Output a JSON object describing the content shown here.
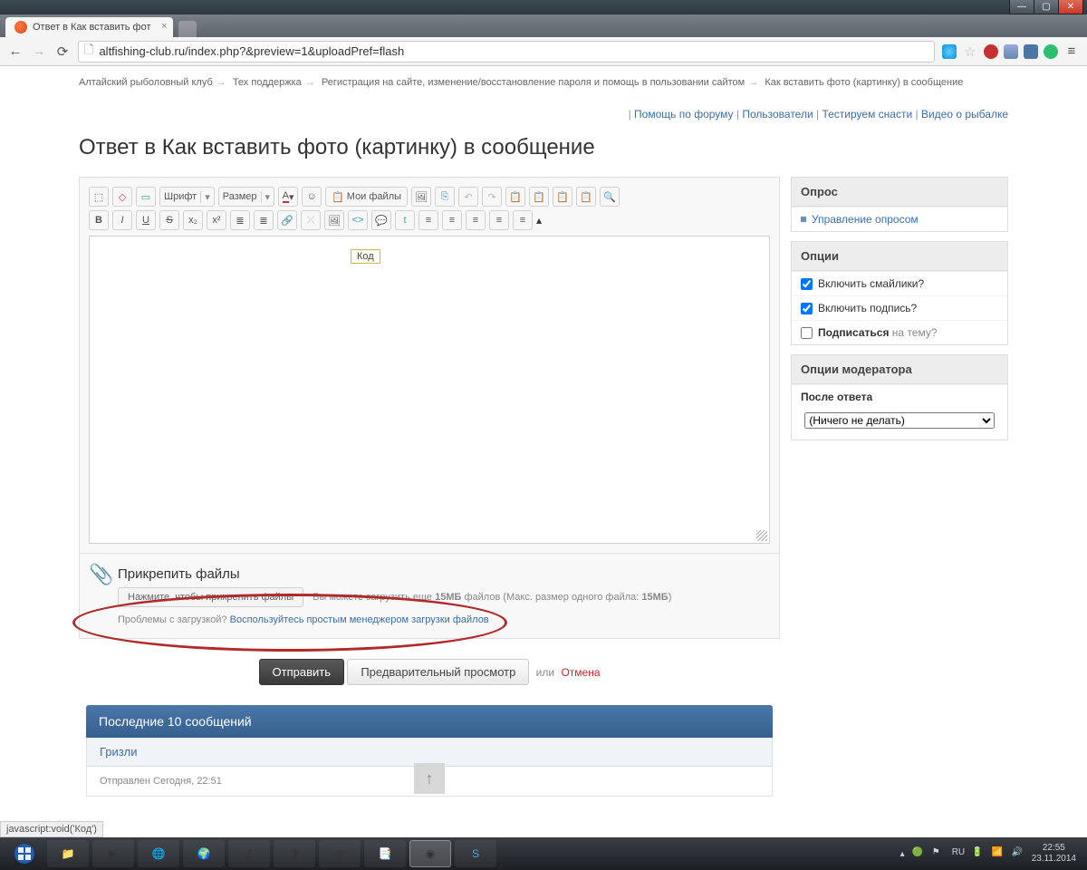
{
  "window": {
    "tab_title": "Ответ в Как вставить фот",
    "url": "altfishing-club.ru/index.php?&preview=1&uploadPref=flash",
    "status_text": "javascript:void('Код')"
  },
  "breadcrumbs": {
    "items": [
      "Алтайский рыболовный клуб",
      "Тех поддержка",
      "Регистрация на сайте, изменение/восстановление пароля и помощь в пользовании сайтом",
      "Как вставить фото (картинку) в сообщение"
    ]
  },
  "toplinks": {
    "items": [
      "Помощь по форуму",
      "Пользователи",
      "Тестируем снасти",
      "Видео о рыбалке"
    ]
  },
  "page_title": "Ответ в Как вставить фото (картинку) в сообщение",
  "toolbar": {
    "font_label": "Шрифт",
    "size_label": "Размер",
    "myfiles": "Мои файлы",
    "tooltip": "Код"
  },
  "attach": {
    "title": "Прикрепить файлы",
    "button": "Нажмите, чтобы прикрепить файлы",
    "info_a": "Вы можете загрузить еще ",
    "info_b": "15МБ",
    "info_c": " файлов (Макс. размер одного файла: ",
    "info_d": "15МБ",
    "info_e": ")",
    "trouble": "Проблемы с загрузкой? ",
    "simple_link": "Воспользуйтесь простым менеджером загрузки файлов"
  },
  "submit": {
    "send": "Отправить",
    "preview": "Предварительный просмотр",
    "or": "или",
    "cancel": "Отмена"
  },
  "sidebar": {
    "poll_head": "Опрос",
    "poll_manage": "Управление опросом",
    "options_head": "Опции",
    "opt1": "Включить смайлики?",
    "opt2": "Включить подпись?",
    "opt3a": "Подписаться",
    "opt3b": " на тему?",
    "mod_head": "Опции модератора",
    "after_label": "После ответа",
    "after_value": "(Ничего не делать)"
  },
  "lastposts": {
    "head": "Последние 10 сообщений",
    "user": "Гризли",
    "meta": "Отправлен Сегодня, 22:51"
  },
  "systray": {
    "time": "22:55",
    "date": "23.11.2014"
  }
}
